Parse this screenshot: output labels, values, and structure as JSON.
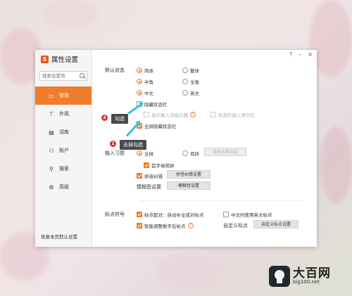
{
  "app": {
    "title": "属性设置",
    "logo_letter": "S"
  },
  "window_controls": {
    "help": "?",
    "minimize": "–",
    "close": "×"
  },
  "search": {
    "placeholder": "搜索设置项"
  },
  "sidebar": {
    "items": [
      {
        "label": "常用",
        "icon": "monitor-icon",
        "glyph": "▭",
        "active": true
      },
      {
        "label": "外观",
        "icon": "shirt-icon",
        "glyph": "👕"
      },
      {
        "label": "词库",
        "icon": "book-icon",
        "glyph": "▤"
      },
      {
        "label": "账户",
        "icon": "user-icon",
        "glyph": "⚇"
      },
      {
        "label": "搜索",
        "icon": "search-icon",
        "glyph": "⚲"
      },
      {
        "label": "高级",
        "icon": "gear-icon",
        "glyph": "⚙"
      }
    ],
    "reset_label": "恢复本页默认设置"
  },
  "default_status": {
    "label": "默认状态",
    "opt_simplified": "简体",
    "opt_traditional": "繁体",
    "opt_halfwidth": "半角",
    "opt_fullwidth": "全角",
    "opt_chinese": "中文",
    "opt_english": "英文",
    "hide_statusbar": "隐藏状态栏",
    "show_ime_indicator": "显示输入法指示器",
    "statusbar_embed": "状态栏嵌入语言栏",
    "fullscreen_hide": "全屏隐藏状态栏"
  },
  "input_habit": {
    "label": "输入习惯",
    "opt_quanpin": "全拼",
    "opt_shuangpin": "双拼",
    "shuangpin_btn": "双拼方案设定",
    "initial_letter": "首字母简拼",
    "pinyin_correction": "拼音纠错",
    "pinyin_correction_btn": "拼音纠错设置",
    "fuzzy_label": "模糊音设置",
    "fuzzy_btn": "模糊音设置"
  },
  "punctuation": {
    "label": "标点符号",
    "auto_pair": "标点配对：自动补全成对标点",
    "cn_use_en": "中文时使用英文标点",
    "smart_adjust": "智能调整数字后标点",
    "custom_label": "自定义标点",
    "custom_btn": "自定义标点设置"
  },
  "annotations": {
    "step1_badge": "1",
    "step1_text": "去掉勾选",
    "step2_badge": "2",
    "step2_text": "勾选"
  },
  "watermark": {
    "brand": "大百网",
    "url": "big100.net"
  },
  "colors": {
    "accent": "#f07c2e",
    "arrow": "#35c2d6",
    "badge": "#d9302b"
  }
}
